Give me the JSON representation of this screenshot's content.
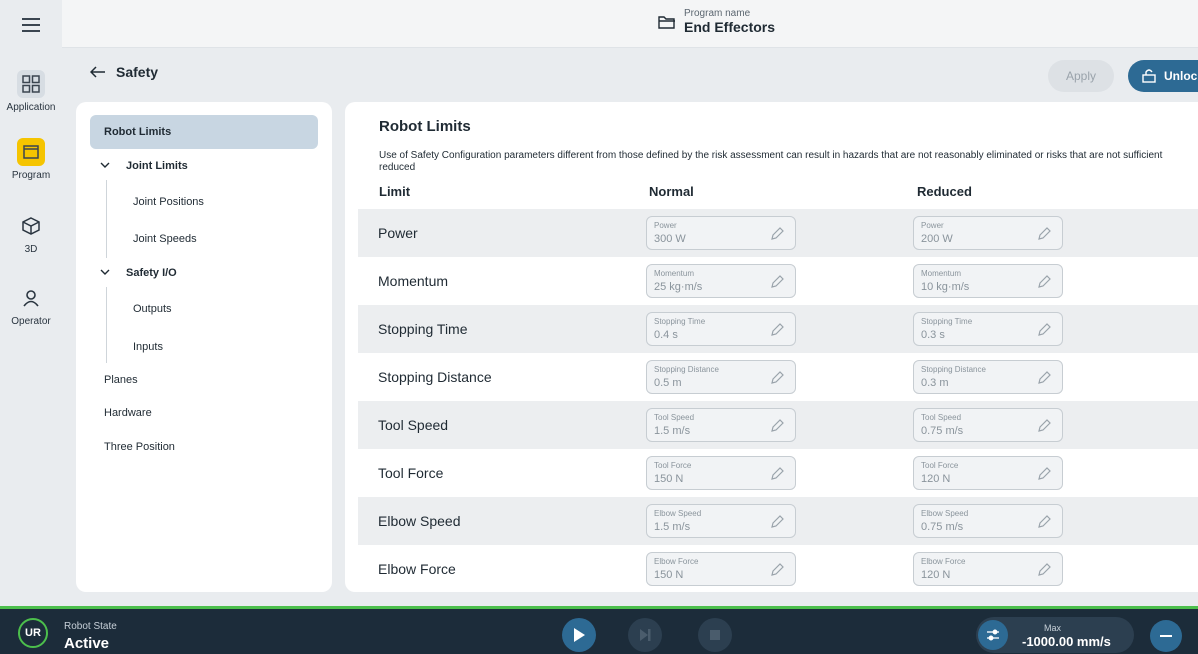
{
  "header": {
    "program_label": "Program name",
    "program_name": "End Effectors"
  },
  "rail": [
    {
      "label": "Application",
      "icon": "grid-icon"
    },
    {
      "label": "Program",
      "icon": "program-icon"
    },
    {
      "label": "3D",
      "icon": "cube-icon"
    },
    {
      "label": "Operator",
      "icon": "user-icon"
    }
  ],
  "page": {
    "title": "Safety",
    "apply": "Apply",
    "unlock": "Unlock"
  },
  "nav": {
    "robot_limits": "Robot Limits",
    "joint_limits": "Joint Limits",
    "joint_positions": "Joint Positions",
    "joint_speeds": "Joint Speeds",
    "safety_io": "Safety I/O",
    "outputs": "Outputs",
    "inputs": "Inputs",
    "planes": "Planes",
    "hardware": "Hardware",
    "three_position": "Three Position"
  },
  "main": {
    "title": "Robot Limits",
    "warning": "Use of Safety Configuration parameters different from those defined by the risk assessment can result in hazards that are not reasonably eliminated or risks that are not sufficient reduced",
    "col_limit": "Limit",
    "col_normal": "Normal",
    "col_reduced": "Reduced",
    "rows": [
      {
        "label": "Power",
        "field": "Power",
        "normal": "300 W",
        "reduced": "200 W"
      },
      {
        "label": "Momentum",
        "field": "Momentum",
        "normal": "25 kg·m/s",
        "reduced": "10 kg·m/s"
      },
      {
        "label": "Stopping Time",
        "field": "Stopping Time",
        "normal": "0.4 s",
        "reduced": "0.3 s"
      },
      {
        "label": "Stopping Distance",
        "field": "Stopping Distance",
        "normal": "0.5 m",
        "reduced": "0.3 m"
      },
      {
        "label": "Tool Speed",
        "field": "Tool Speed",
        "normal": "1.5 m/s",
        "reduced": "0.75 m/s"
      },
      {
        "label": "Tool Force",
        "field": "Tool Force",
        "normal": "150 N",
        "reduced": "120 N"
      },
      {
        "label": "Elbow Speed",
        "field": "Elbow Speed",
        "normal": "1.5 m/s",
        "reduced": "0.75 m/s"
      },
      {
        "label": "Elbow Force",
        "field": "Elbow Force",
        "normal": "150 N",
        "reduced": "120 N"
      }
    ]
  },
  "bottom": {
    "logo": "UR",
    "state_label": "Robot State",
    "state_value": "Active",
    "speed_label": "Max",
    "speed_value": "-1000.00 mm/s"
  },
  "colors": {
    "accent": "#2d6a94",
    "program": "#f5c400",
    "status": "#4cbf4c",
    "footer": "#1c2c3a"
  }
}
